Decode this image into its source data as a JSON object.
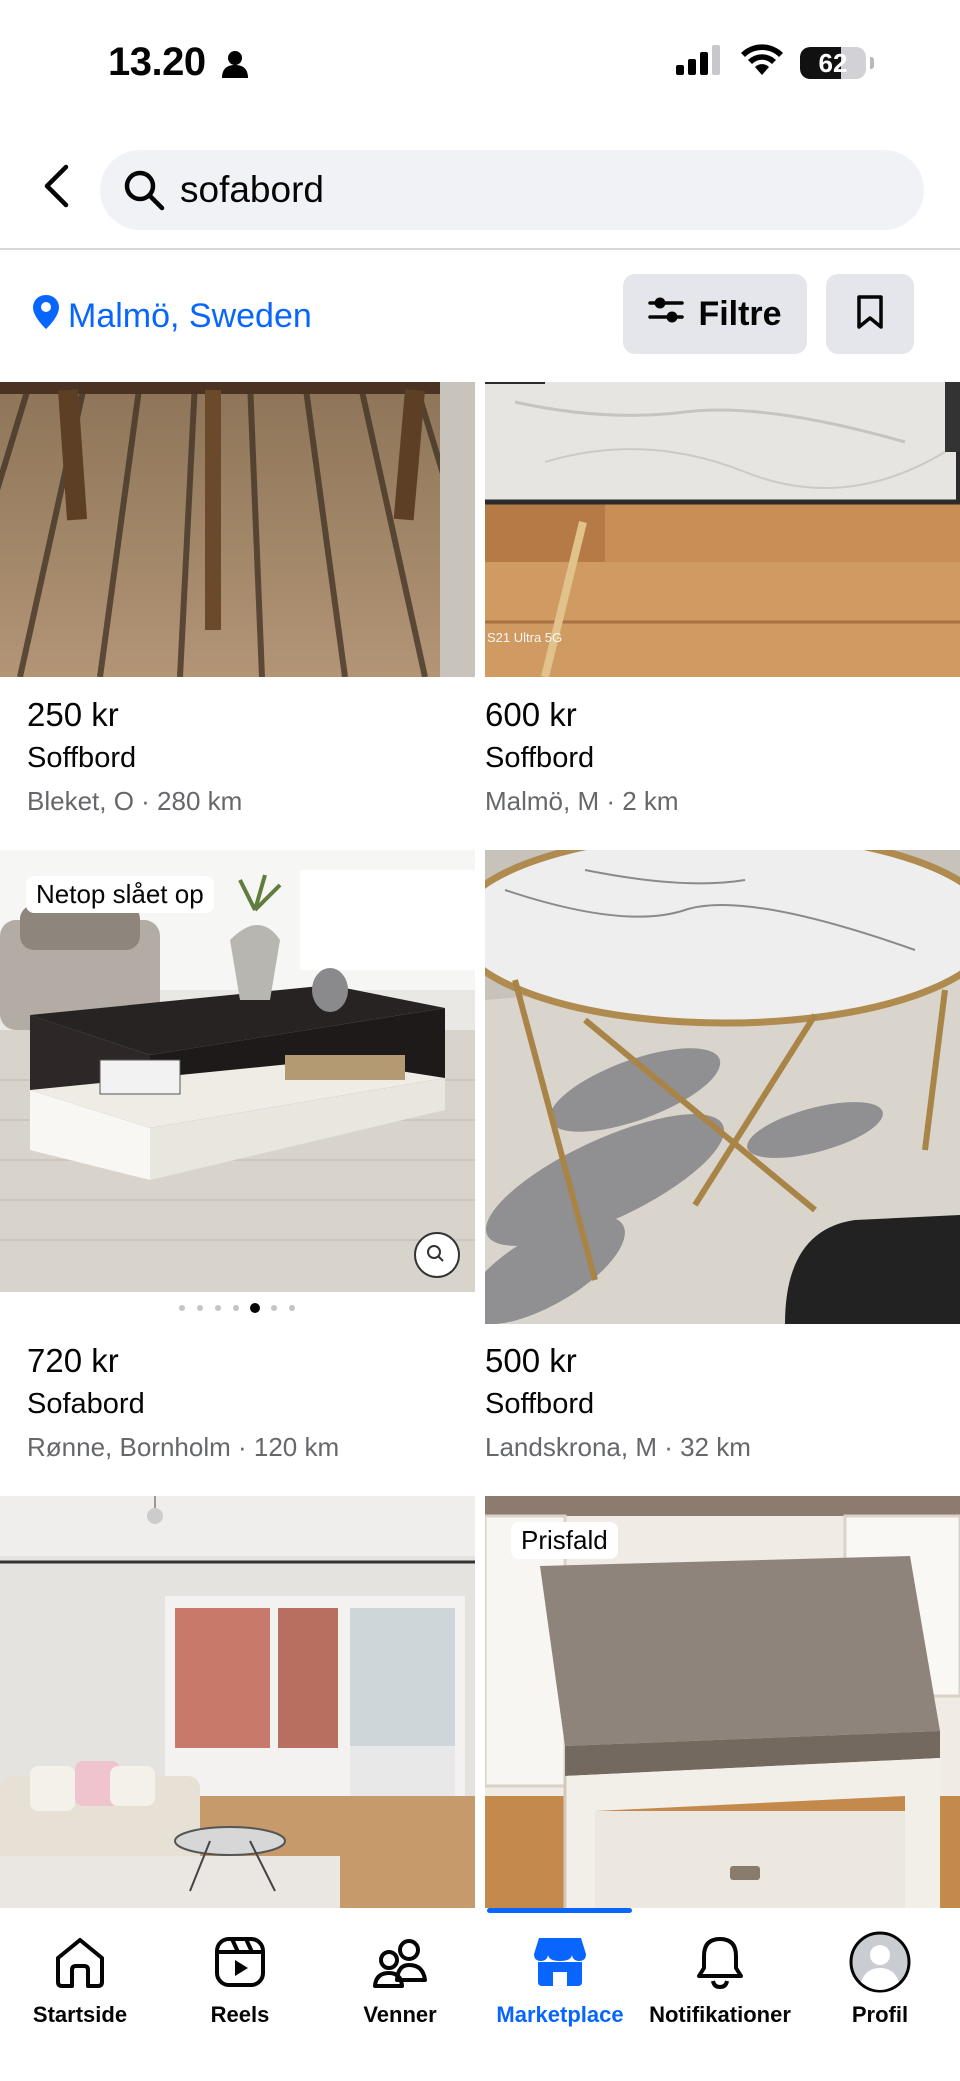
{
  "status_bar": {
    "time": "13.20",
    "battery": "62",
    "battery_level": 0.62
  },
  "search": {
    "query": "sofabord",
    "back_icon": "chevron-left-icon",
    "search_icon": "search-icon"
  },
  "location": {
    "label": "Malmö, Sweden",
    "icon": "location-pin-icon"
  },
  "filter": {
    "label": "Filtre",
    "icon": "sliders-icon"
  },
  "save_icon": "bookmark-icon",
  "colors": {
    "accent": "#0866ff",
    "secondary_text": "#65676b",
    "button_bg": "#e4e6eb",
    "search_bg": "#f0f2f5"
  },
  "listings": [
    {
      "price": "250 kr",
      "title": "Soffbord",
      "location": "Bleket, O · 280 km",
      "badge": ""
    },
    {
      "price": "600 kr",
      "title": "Soffbord",
      "location": "Malmö, M · 2 km",
      "badge": "",
      "photo_caption": "S21 Ultra 5G"
    },
    {
      "price": "720 kr",
      "title": "Sofabord",
      "location": "Rønne, Bornholm · 120 km",
      "badge": "Netop slået op"
    },
    {
      "price": "500 kr",
      "title": "Soffbord",
      "location": "Landskrona, M · 32 km",
      "badge": ""
    },
    {
      "price": "",
      "title": "",
      "location": "",
      "badge": ""
    },
    {
      "price": "",
      "title": "",
      "location": "",
      "badge": "Prisfald"
    }
  ],
  "tabs": [
    {
      "label": "Startside",
      "icon": "home-icon"
    },
    {
      "label": "Reels",
      "icon": "reels-icon"
    },
    {
      "label": "Venner",
      "icon": "friends-icon"
    },
    {
      "label": "Marketplace",
      "icon": "marketplace-icon",
      "active": true
    },
    {
      "label": "Notifikationer",
      "icon": "bell-icon"
    },
    {
      "label": "Profil",
      "icon": "profile-avatar-icon"
    }
  ]
}
